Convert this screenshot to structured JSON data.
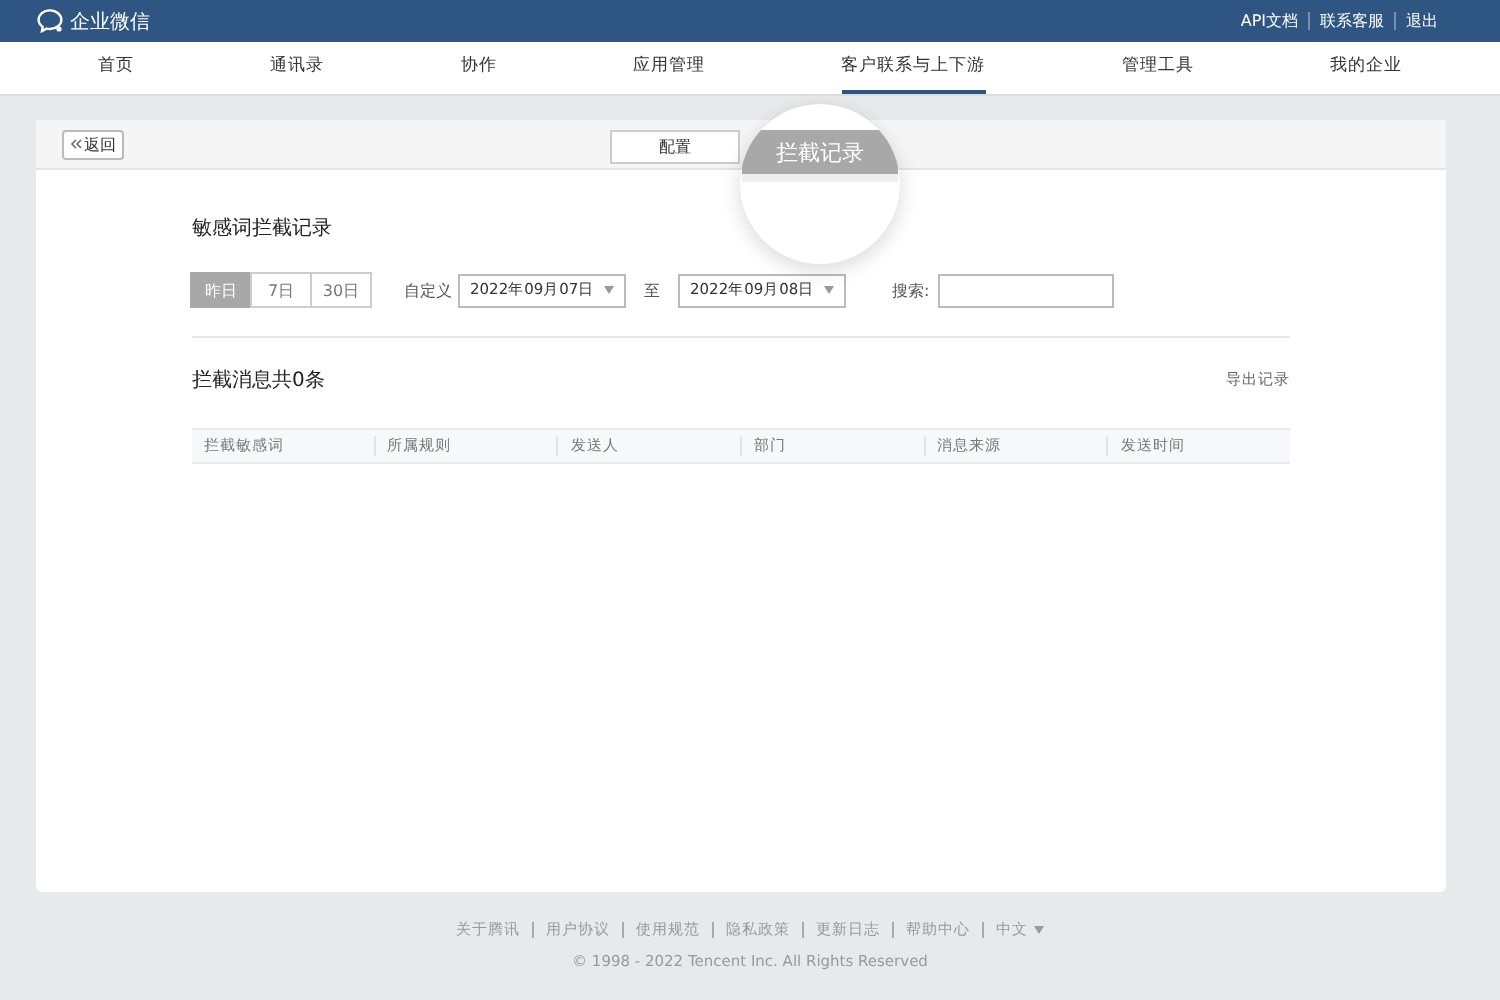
{
  "header": {
    "logo_text": "企业微信",
    "links": [
      "API文档",
      "联系客服",
      "退出"
    ]
  },
  "nav": [
    {
      "label": "首页",
      "selected": false
    },
    {
      "label": "通讯录",
      "selected": false
    },
    {
      "label": "协作",
      "selected": false
    },
    {
      "label": "应用管理",
      "selected": false
    },
    {
      "label": "客户联系与上下游",
      "selected": true
    },
    {
      "label": "管理工具",
      "selected": false
    },
    {
      "label": "我的企业",
      "selected": false
    }
  ],
  "back_button": "返回",
  "tabs": [
    {
      "label": "配置",
      "selected": false
    },
    {
      "label": "拦截记录",
      "selected": true
    }
  ],
  "section_title": "敏感词拦截记录",
  "ranges": [
    {
      "label": "昨日",
      "selected": true
    },
    {
      "label": "7日",
      "selected": false
    },
    {
      "label": "30日",
      "selected": false
    }
  ],
  "custom_label": "自定义",
  "start_date": "2022年09月07日",
  "to_label": "至",
  "end_date": "2022年09月08日",
  "search_label": "搜索:",
  "count_title": "拦截消息共0条",
  "export_link": "导出记录",
  "table": {
    "columns": [
      "拦截敏感词",
      "所属规则",
      "发送人",
      "部门",
      "消息来源",
      "发送时间"
    ]
  },
  "footer": {
    "links": [
      "关于腾讯",
      "用户协议",
      "使用规范",
      "隐私政策",
      "更新日志",
      "帮助中心"
    ],
    "language": "中文",
    "copyright": "© 1998 - 2022 Tencent Inc. All Rights Reserved"
  }
}
